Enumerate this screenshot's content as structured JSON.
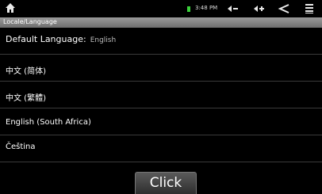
{
  "status_bar": {
    "time": "3:48 PM",
    "icons": [
      "home-icon",
      "battery-icon",
      "volume-down-icon",
      "volume-up-icon",
      "back-icon",
      "menu-icon"
    ],
    "battery_color": "#3bd13b"
  },
  "header": {
    "title": "Locale/Language"
  },
  "default_language": {
    "label": "Default Language:",
    "value": "English"
  },
  "languages": [
    "中文 (简体)",
    "中文 (繁體)",
    "English (South Africa)",
    "Čeština"
  ],
  "click_button": {
    "label": "Click"
  }
}
